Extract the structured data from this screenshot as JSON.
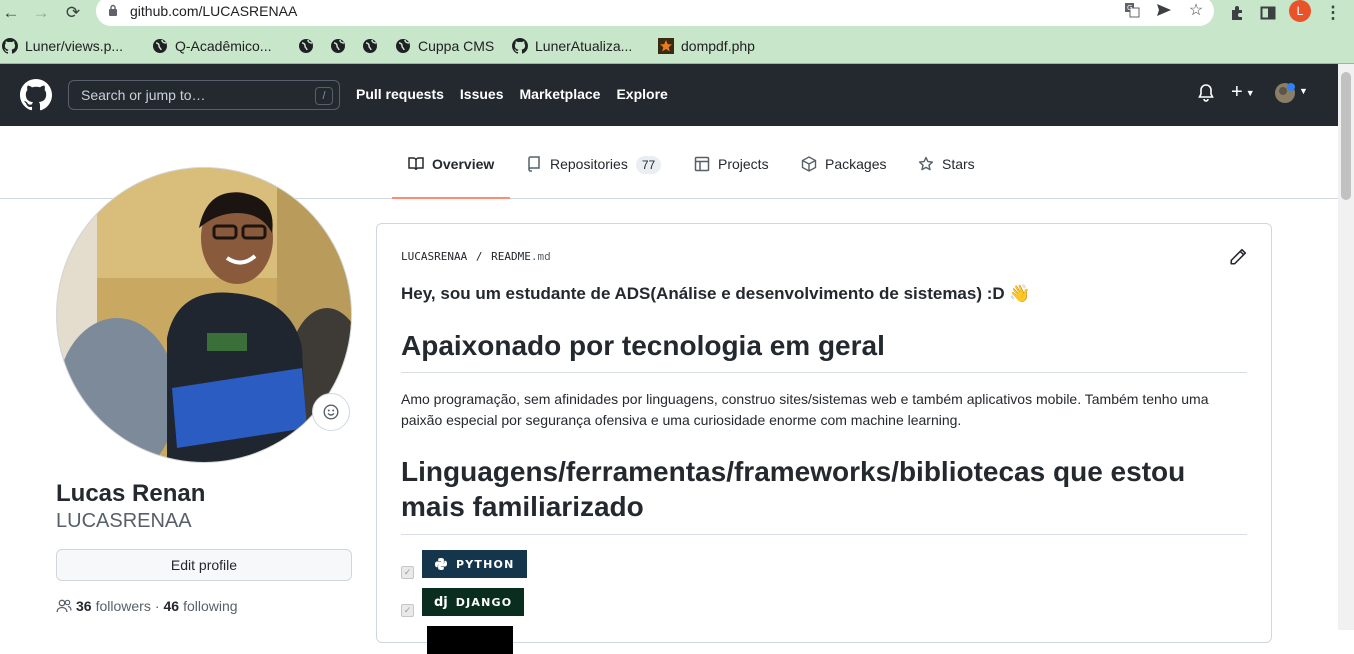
{
  "browser": {
    "url_host": "github.com/",
    "url_path": "LUCASRENAA",
    "profile_initial": "L"
  },
  "bookmarks": [
    {
      "label": "Luner/views.p...",
      "icon": "github-icon"
    },
    {
      "label": "Q-Acadêmico...",
      "icon": "globe-icon"
    },
    {
      "label": "",
      "icon": "globe-icon"
    },
    {
      "label": "",
      "icon": "globe-icon"
    },
    {
      "label": "",
      "icon": "globe-icon"
    },
    {
      "label": "Cuppa CMS",
      "icon": "globe-icon"
    },
    {
      "label": "LunerAtualiza...",
      "icon": "github-icon"
    },
    {
      "label": "dompdf.php",
      "icon": "star-icon"
    }
  ],
  "header": {
    "search_placeholder": "Search or jump to…",
    "search_shortcut": "/",
    "nav": [
      "Pull requests",
      "Issues",
      "Marketplace",
      "Explore"
    ],
    "plus": "+"
  },
  "tabs": [
    {
      "label": "Overview",
      "icon": "book-icon",
      "active": true
    },
    {
      "label": "Repositories",
      "icon": "repo-icon",
      "count": "77"
    },
    {
      "label": "Projects",
      "icon": "table-icon"
    },
    {
      "label": "Packages",
      "icon": "package-icon"
    },
    {
      "label": "Stars",
      "icon": "star-icon"
    }
  ],
  "profile": {
    "full_name": "Lucas Renan",
    "login": "LUCASRENAA",
    "edit_label": "Edit profile",
    "followers_count": "36",
    "followers_label": "followers",
    "separator": "·",
    "following_count": "46",
    "following_label": "following"
  },
  "readme": {
    "owner": "LUCASRENAA",
    "sep": "/",
    "file": "README",
    "ext": ".md",
    "greeting": "Hey, sou um estudante de ADS(Análise e desenvolvimento de sistemas) :D 👋",
    "heading1": "Apaixonado por tecnologia em geral",
    "paragraph": "Amo programação, sem afinidades por linguagens, construo sites/sistemas web e também aplicativos mobile. Também tenho uma paixão especial por segurança ofensiva e uma curiosidade enorme com machine learning.",
    "heading2": "Linguagens/ferramentas/frameworks/bibliotecas que estou mais familiarizado",
    "badges": [
      {
        "label": "PYTHON",
        "color": "#14354c"
      },
      {
        "label": "DJANGO",
        "color": "#092e20"
      },
      {
        "label": "",
        "color": "#000000"
      }
    ]
  },
  "colors": {
    "chrome_bg": "#c8e6c9",
    "github_header": "#24292f",
    "tab_underline": "#fd8c73"
  }
}
